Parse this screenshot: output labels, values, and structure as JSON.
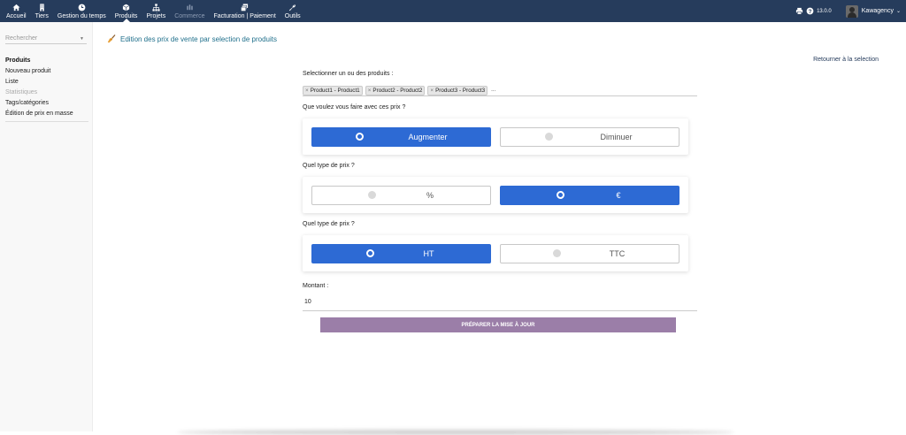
{
  "topnav": {
    "items": [
      {
        "label": "Accueil",
        "icon": "home-icon"
      },
      {
        "label": "Tiers",
        "icon": "building-icon"
      },
      {
        "label": "Gestion du temps",
        "icon": "clock-icon"
      },
      {
        "label": "Produits",
        "icon": "cube-icon",
        "active": true
      },
      {
        "label": "Projets",
        "icon": "sitemap-icon"
      },
      {
        "label": "Commerce",
        "icon": "suitcase-icon",
        "disabled": true
      },
      {
        "label": "Facturation | Paiement",
        "icon": "file-invoice-icon"
      },
      {
        "label": "Outils",
        "icon": "wrench-icon"
      }
    ],
    "version": "13.0.0",
    "username": "Kawagency"
  },
  "sidebar": {
    "search_placeholder": "Rechercher",
    "menu_title": "Produits",
    "items": [
      {
        "label": "Nouveau produit"
      },
      {
        "label": "Liste"
      },
      {
        "label": "Statistiques",
        "disabled": true
      },
      {
        "label": "Tags/catégories"
      },
      {
        "label": "Édition de prix en masse"
      }
    ]
  },
  "page": {
    "title": "Edition des prix de vente par selection de produits",
    "back_link": "Retourner à la selection"
  },
  "form": {
    "products_label": "Selectionner un ou des produits :",
    "products": [
      "Product1 - Product1",
      "Product2 - Product2",
      "Product3 - Product3"
    ],
    "products_more": "...",
    "action_label": "Que voulez vous faire avec ces prix ?",
    "action_options": [
      "Augmenter",
      "Diminuer"
    ],
    "type_label": "Quel type de prix ?",
    "type_options": [
      "%",
      "€"
    ],
    "tax_label": "Quel type de prix ?",
    "tax_options": [
      "HT",
      "TTC"
    ],
    "amount_label": "Montant :",
    "amount_value": "10",
    "submit_label": "PRÉPARER LA MISE À JOUR"
  },
  "colors": {
    "topbar": "#263c5c",
    "selected_option": "#2d6ad4",
    "submit_button": "#9b7ea8",
    "title_text": "#1f6f8b"
  }
}
